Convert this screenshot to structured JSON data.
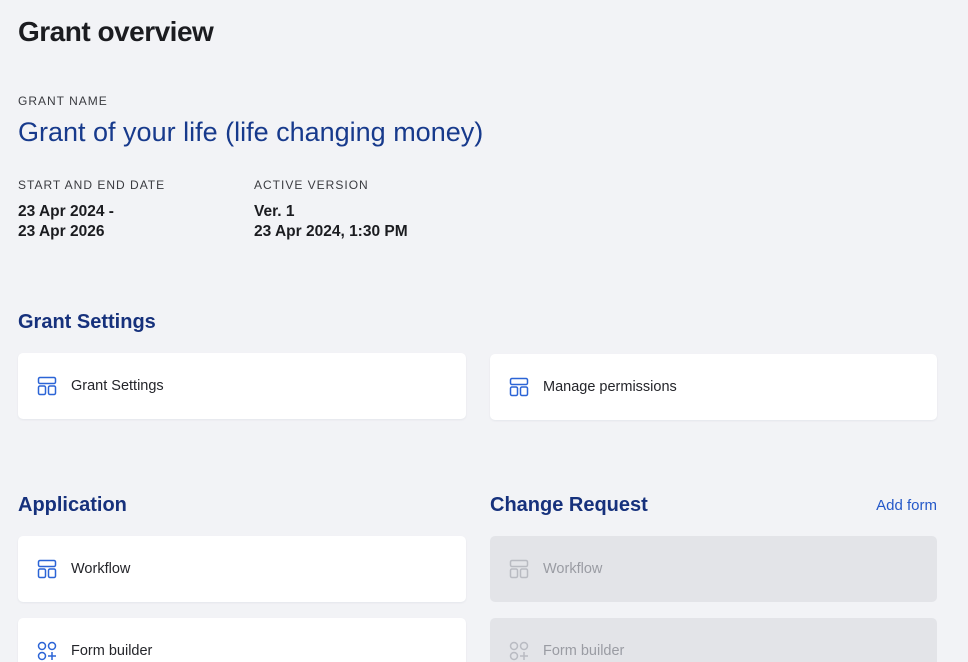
{
  "header": {
    "title": "Grant overview"
  },
  "grant": {
    "name_label": "GRANT NAME",
    "name": "Grant of your life (life changing money)",
    "dates_label": "START AND END DATE",
    "start_date": "23 Apr 2024 -",
    "end_date": "23 Apr 2026",
    "version_label": "ACTIVE VERSION",
    "version_name": "Ver. 1",
    "version_date": "23 Apr 2024, 1:30 PM"
  },
  "settings": {
    "heading": "Grant Settings",
    "items": [
      {
        "label": "Grant Settings",
        "icon": "layout-icon"
      },
      {
        "label": "Manage permissions",
        "icon": "layout-icon"
      }
    ]
  },
  "application": {
    "heading": "Application",
    "items": [
      {
        "label": "Workflow",
        "icon": "layout-icon"
      },
      {
        "label": "Form builder",
        "icon": "grid-add-icon"
      }
    ]
  },
  "change_request": {
    "heading": "Change Request",
    "add_form_label": "Add form",
    "items": [
      {
        "label": "Workflow",
        "icon": "layout-icon",
        "disabled": true
      },
      {
        "label": "Form builder",
        "icon": "grid-add-icon",
        "disabled": true
      }
    ]
  },
  "colors": {
    "accent": "#2458c8",
    "heading": "#16317c",
    "grant_name": "#173a8c",
    "icon": "#2b64d6",
    "icon_disabled": "#b9bbc2"
  }
}
